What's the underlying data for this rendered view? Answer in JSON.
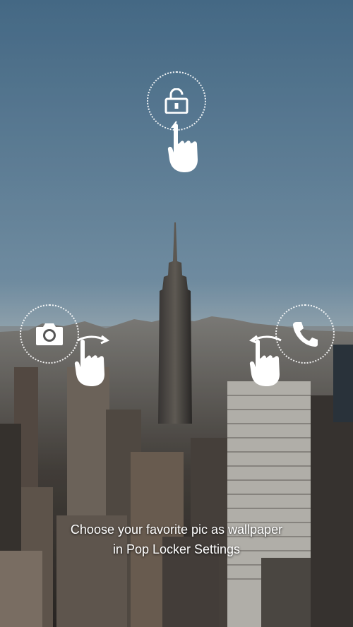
{
  "lockscreen": {
    "hint_line1": "Choose your favorite pic as wallpaper",
    "hint_line2": "in Pop Locker Settings",
    "unlock_icon": "unlock-icon",
    "camera_icon": "camera-icon",
    "phone_icon": "phone-icon",
    "gesture_icon": "swipe-hand-icon"
  },
  "colors": {
    "sky_top": "#5f86a6",
    "sky_bottom": "#b9c8cf",
    "city": "#5b5650",
    "accent": "#ffffff"
  }
}
